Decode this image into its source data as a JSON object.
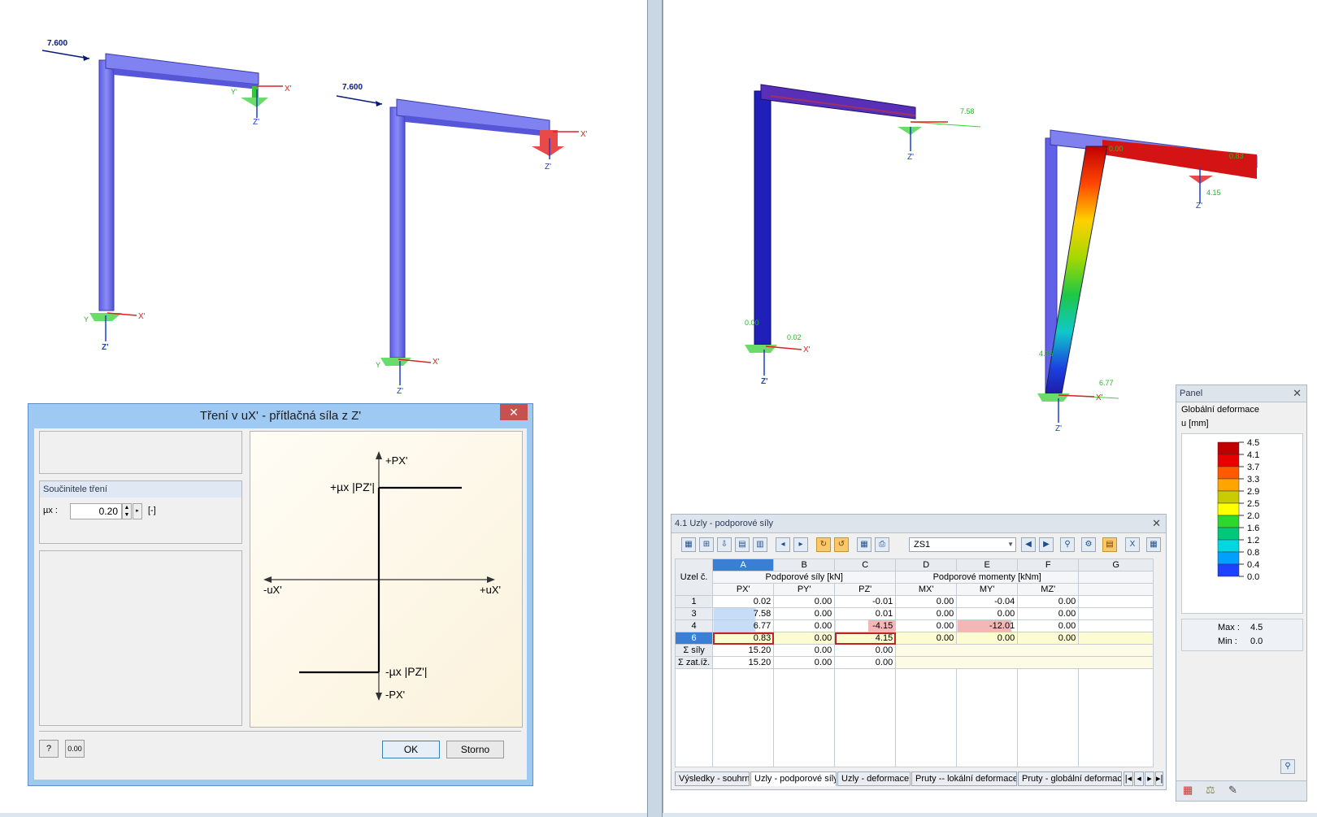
{
  "left_view": {
    "load_label_1": "7.600",
    "load_label_2": "7.600",
    "axes": {
      "x": "X'",
      "y": "Y'",
      "z": "Z'"
    }
  },
  "dialog": {
    "title": "Tření v uX' - přítlačná síla z Z'",
    "close": "✕",
    "group_title": "Součinitele tření",
    "mu_label": "µx :",
    "mu_value": "0.20",
    "mu_unit": "[-]",
    "diagram": {
      "plus_p": "+PX'",
      "minus_p": "-PX'",
      "plus_u": "+uX'",
      "minus_u": "-uX'",
      "upper": "+µx |PZ'|",
      "lower": "-µx |PZ'|"
    },
    "ok": "OK",
    "cancel": "Storno",
    "help_icon": "help-icon",
    "units_icon_text": "0.00"
  },
  "right_view": {
    "labels": [
      "7.58",
      "0.83",
      "4.15",
      "0.02",
      "6.77",
      "4.15",
      "0.00",
      "0.00"
    ]
  },
  "results": {
    "title": "4.1 Uzly - podporové síly",
    "combo": "ZS1",
    "col_letters": [
      "A",
      "B",
      "C",
      "D",
      "E",
      "F",
      "G"
    ],
    "row_header": "Uzel č.",
    "group_forces": "Podporové síly [kN]",
    "group_moments": "Podporové momenty [kNm]",
    "sub_headers": [
      "PX'",
      "PY'",
      "PZ'",
      "MX'",
      "MY'",
      "MZ'"
    ],
    "rows": [
      {
        "id": "1",
        "vals": [
          "0.02",
          "0.00",
          "-0.01",
          "0.00",
          "-0.04",
          "0.00"
        ]
      },
      {
        "id": "3",
        "vals": [
          "7.58",
          "0.00",
          "0.01",
          "0.00",
          "0.00",
          "0.00"
        ]
      },
      {
        "id": "4",
        "vals": [
          "6.77",
          "0.00",
          "-4.15",
          "0.00",
          "-12.01",
          "0.00"
        ]
      },
      {
        "id": "6",
        "vals": [
          "0.83",
          "0.00",
          "4.15",
          "0.00",
          "0.00",
          "0.00"
        ]
      }
    ],
    "sum_forces": {
      "label": "Σ síly",
      "vals": [
        "15.20",
        "0.00",
        "0.00"
      ]
    },
    "sum_loads": {
      "label": "Σ zat.íž.",
      "vals": [
        "15.20",
        "0.00",
        "0.00"
      ]
    },
    "tabs": [
      "Výsledky - souhrn",
      "Uzly - podporové síly",
      "Uzly - deformace",
      "Pruty -- lokální deformace",
      "Pruty - globální deformace"
    ]
  },
  "panel": {
    "title": "Panel",
    "heading": "Globální deformace",
    "unit": "u [mm]",
    "scale": [
      "4.5",
      "4.1",
      "3.7",
      "3.3",
      "2.9",
      "2.5",
      "2.0",
      "1.6",
      "1.2",
      "0.8",
      "0.4",
      "0.0"
    ],
    "max_label": "Max  :",
    "max_val": "4.5",
    "min_label": "Min  :",
    "min_val": "0.0"
  }
}
